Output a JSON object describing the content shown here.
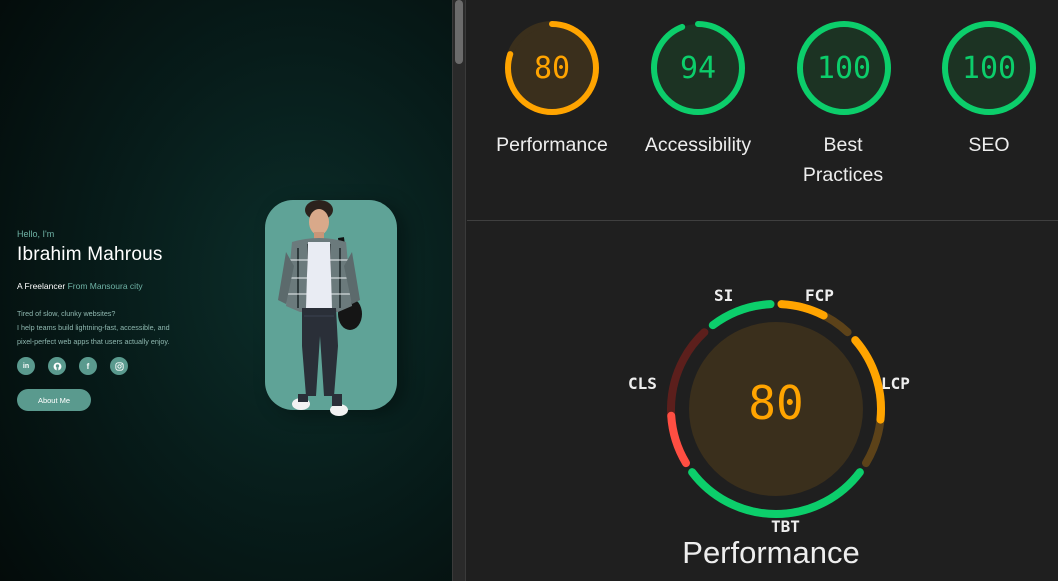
{
  "portfolio": {
    "greeting": "Hello, I'm",
    "name": "Ibrahim Mahrous",
    "role": "A Freelancer",
    "location": "From Mansoura city",
    "description_lines": [
      "Tired of slow, clunky websites?",
      "I help teams build lightning-fast, accessible, and",
      "pixel-perfect web apps that users actually enjoy."
    ],
    "socials": [
      "linkedin-icon",
      "github-icon",
      "facebook-icon",
      "instagram-icon"
    ],
    "socials_text": {
      "linkedin": "in",
      "facebook": "f"
    },
    "about_button": "About Me",
    "colors": {
      "accent": "#5a9a8e",
      "text_muted": "#6fb3a6"
    }
  },
  "lighthouse": {
    "categories": [
      {
        "label": "Performance",
        "score": 80,
        "color": "#ffa400"
      },
      {
        "label": "Accessibility",
        "score": 94,
        "color": "#0cce6b"
      },
      {
        "label": "Best Practices",
        "label_line1": "Best",
        "label_line2": "Practices",
        "score": 100,
        "color": "#0cce6b"
      },
      {
        "label": "SEO",
        "score": 100,
        "color": "#0cce6b"
      }
    ],
    "performance": {
      "score": 80,
      "title": "Performance",
      "metrics": [
        {
          "label": "SI",
          "status": "pass"
        },
        {
          "label": "FCP",
          "status": "average"
        },
        {
          "label": "LCP",
          "status": "average"
        },
        {
          "label": "TBT",
          "status": "pass"
        },
        {
          "label": "CLS",
          "status": "fail"
        }
      ]
    },
    "colors": {
      "pass": "#0cce6b",
      "average": "#ffa400",
      "fail": "#ff4e42"
    }
  }
}
